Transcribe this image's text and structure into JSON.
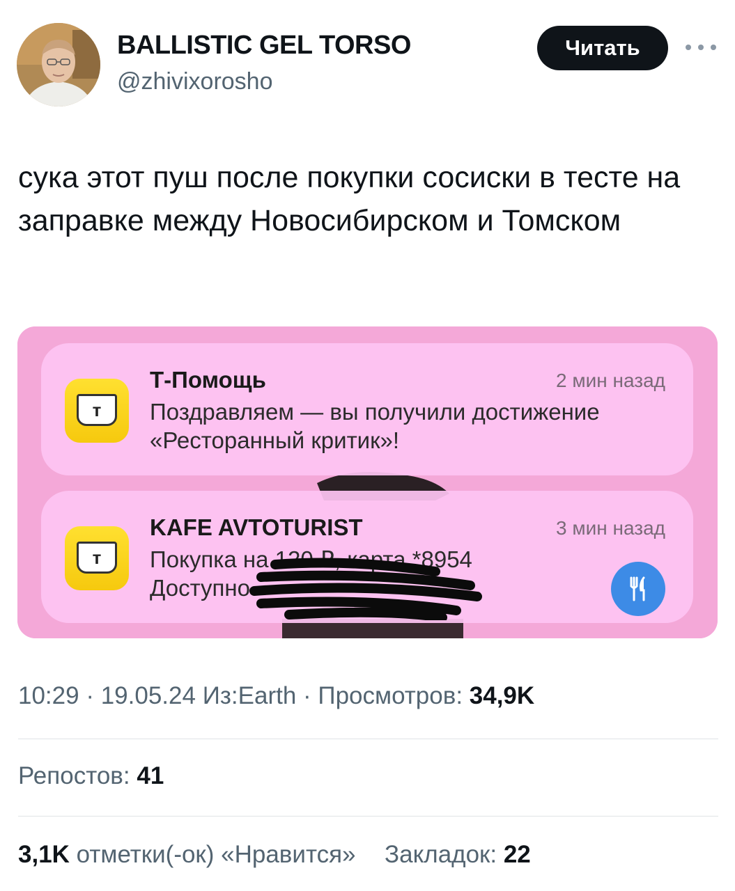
{
  "header": {
    "display_name": "BALLISTIC GEL TORSO",
    "handle": "@zhivixorosho",
    "follow_label": "Читать"
  },
  "tweet": {
    "text": "сука этот пуш после покупки сосиски в тесте на заправке между Новосибирском и Томском"
  },
  "media": {
    "notifications": [
      {
        "app_icon": "t-bank-shield-icon",
        "app_letter": "т",
        "title": "Т-Помощь",
        "time": "2 мин назад",
        "body": "Поздравляем — вы получили достижение «Ресторанный критик»!"
      },
      {
        "app_icon": "t-bank-shield-icon",
        "app_letter": "т",
        "title": "KAFE AVTOTURIST",
        "time": "3 мин назад",
        "body_line1": "Покупка на 120 ₽, карта *8954",
        "body_line2": "Доступно",
        "category_icon": "fork-knife-icon"
      }
    ],
    "colors": {
      "background": "#f4a8d8",
      "card": "#fdc4f2",
      "badge": "#3d8be6",
      "app_icon": "#f6c90e"
    }
  },
  "meta": {
    "time": "10:29",
    "date": "19.05.24",
    "source": "Из:Earth",
    "views_label": "Просмотров:",
    "views_value": "34,9K"
  },
  "stats": {
    "reposts_label": "Репостов:",
    "reposts_value": "41",
    "likes_value": "3,1K",
    "likes_label": "отметки(-ок) «Нравится»",
    "bookmarks_label": "Закладок:",
    "bookmarks_value": "22"
  }
}
